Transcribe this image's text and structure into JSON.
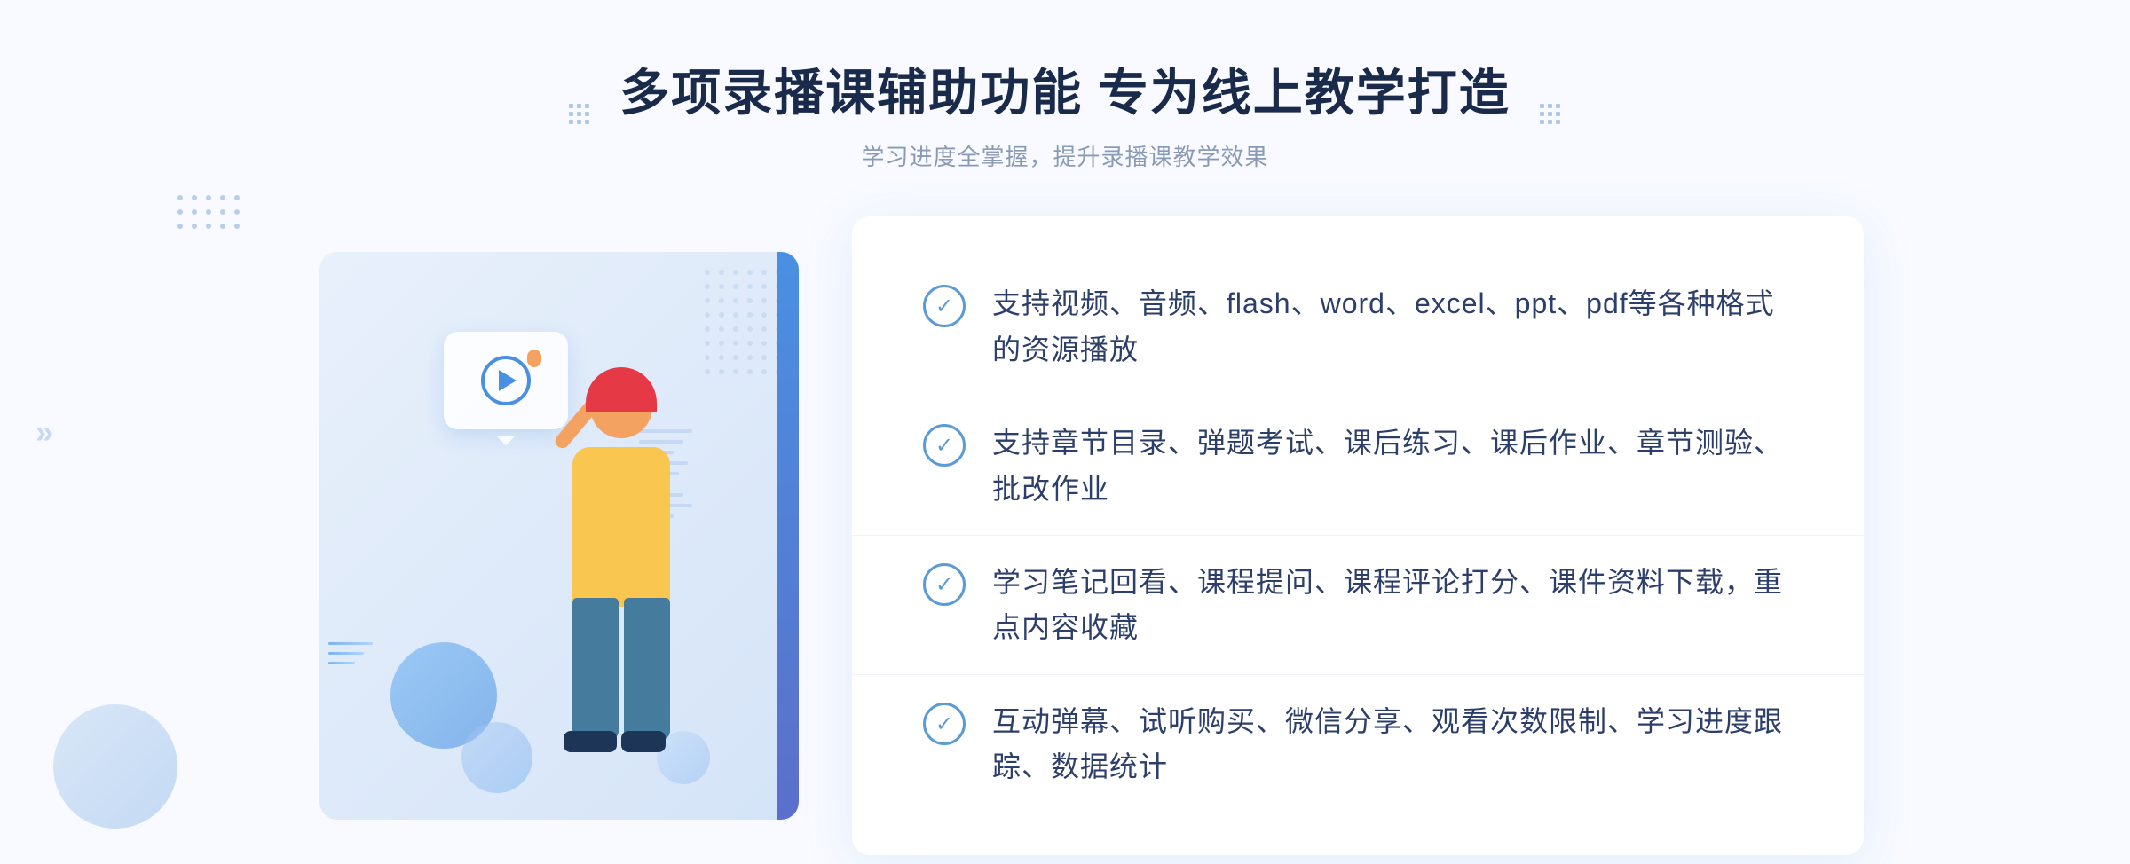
{
  "page": {
    "background_color": "#f4f8fe",
    "title": "多项录播课辅助功能 专为线上教学打造",
    "subtitle": "学习进度全掌握，提升录播课教学效果"
  },
  "header": {
    "title": "多项录播课辅助功能 专为线上教学打造",
    "subtitle": "学习进度全掌握，提升录播课教学效果"
  },
  "features": [
    {
      "id": 1,
      "text": "支持视频、音频、flash、word、excel、ppt、pdf等各种格式的资源播放"
    },
    {
      "id": 2,
      "text": "支持章节目录、弹题考试、课后练习、课后作业、章节测验、批改作业"
    },
    {
      "id": 3,
      "text": "学习笔记回看、课程提问、课程评论打分、课件资料下载，重点内容收藏"
    },
    {
      "id": 4,
      "text": "互动弹幕、试听购买、微信分享、观看次数限制、学习进度跟踪、数据统计"
    }
  ],
  "icons": {
    "check": "✓",
    "play": "▶",
    "chevron_left": "«",
    "decoration_dots": "⁞⁞"
  },
  "colors": {
    "primary_blue": "#4a90e2",
    "dark_blue": "#1a2a4a",
    "text_color": "#2c3e6a",
    "subtitle_color": "#8a9ab5",
    "border_color": "#f0f4fa",
    "light_blue_bg": "#e8f2fb"
  }
}
